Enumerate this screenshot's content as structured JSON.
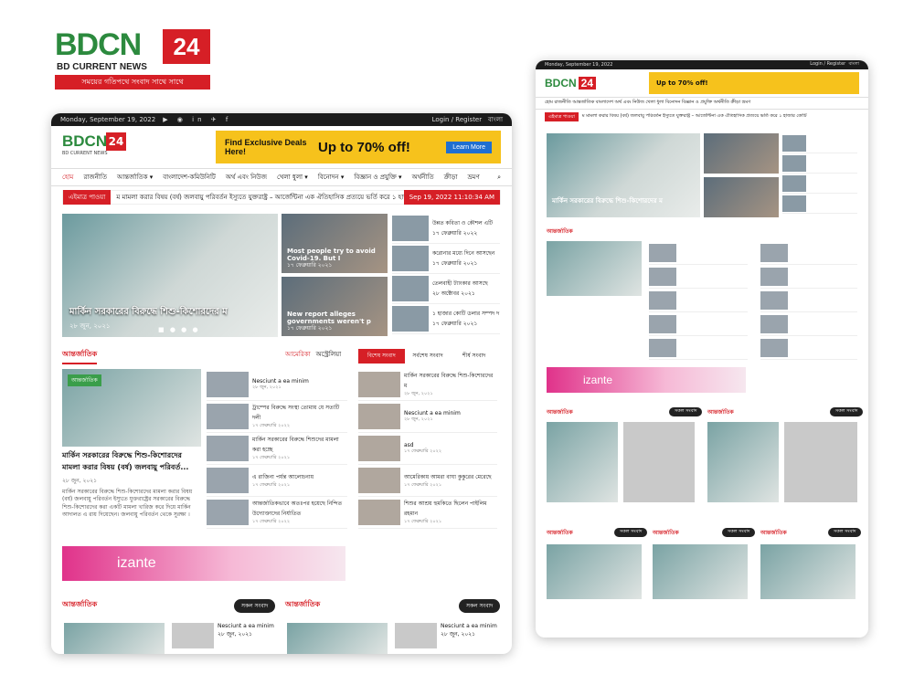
{
  "brand": {
    "word": "BDCN",
    "num": "24",
    "sub": "BD CURRENT NEWS",
    "tagline": "সময়ের গতিপথে সংবাদ সাথে সাথে"
  },
  "desktop": {
    "topbar": {
      "date": "Monday, September 19, 2022",
      "social": "▶ ◉ in ✈ f",
      "login": "Login",
      "register": "Register",
      "lang": "বাংলা"
    },
    "ad": {
      "line1": "Find Exclusive Deals Here!",
      "line2": "Up to 70% off!",
      "button": "Learn More"
    },
    "nav": [
      "হোম",
      "রাজনীতি",
      "আন্তর্জাতিক ▾",
      "বাংলাদেশ-কমিউনিটি",
      "অর্থ এবং নিউজ",
      "খেলা ধুলা ▾",
      "বিনোদন ▾",
      "বিজ্ঞান ও প্রযুক্তি ▾",
      "অর্থনীতি",
      "ক্রীড়া",
      "ভ্রমণ"
    ],
    "ticker": {
      "label": "এইমাত্র পাওয়া",
      "text": "ম মামলা করার বিষয় (বর্ষ) জলবায়ু পরিবর্তন ইস্যুতে যুক্তরাষ্ট্র – আর্জেন্টিনা এক ঐতিহাসিক প্রত্যয়ে ভর্তি করে ১ হাজার কোটি",
      "date": "Sep 19, 2022 11:10:34 AM"
    },
    "hero": {
      "caption": "মার্কিন সরকারের বিরুদ্ধে শিশু-কিশোরদের ম",
      "date": "২৮ জুন, ২০২১",
      "dots": "■ ● ● ●"
    },
    "mid": [
      {
        "title": "Most people try to avoid Covid-19. But I",
        "date": "১৭ ফেব্রুয়ারি ২০২১"
      },
      {
        "title": "New report alleges governments weren't p",
        "date": "১৭ ফেব্রুয়ারি ২০২১"
      }
    ],
    "right": [
      {
        "t": "উন্নত কবিতা ও কৌশল এটি",
        "d": "১৭ ফেব্রুয়ারি ২০২২"
      },
      {
        "t": "করোনার মধ্যে দিনে আসছেন",
        "d": "১৭ ফেব্রুয়ারি ২০২১"
      },
      {
        "t": "তেলবাহী ট্যাংকার আসছে",
        "d": "২৮ অক্টোবর ২০২১"
      },
      {
        "t": "১ হাজার কোটি ডলার সম্পদ দ",
        "d": "১৭ ফেব্রুয়ারি ২০২১"
      }
    ],
    "section1": {
      "title": "আন্তর্জাতিক",
      "tabs": [
        "আমেরিকা",
        "অস্ট্রেলিয়া"
      ]
    },
    "lead": {
      "badge": "আন্তর্জাতিক",
      "title": "মার্কিন সরকারের বিরুদ্ধে শিশু-কিশোরদের মামলা করার বিষয় (বর্ষ) জলবায়ু পরিবর্ত...",
      "date": "২৮ জুন, ২০২১",
      "body": "মার্কিন সরকারের বিরুদ্ধে শিশু-কিশোরদের মামলা করার বিষয় (বর্ষ) জলবায়ু পরিবর্তন ইস্যুতে যুক্তরাষ্ট্রের সরকারের বিরুদ্ধে শিশু-কিশোরদের করা একটি মামলা খারিজ করে দিয়ে মার্কিন আদালত এ রায় দিয়েছেন। জলবায়ু পরিবর্তন থেকে সুরক্ষা ।"
    },
    "slist": [
      {
        "t": "Nesciunt a ea minim",
        "d": "২৮ জুন, ২০২১"
      },
      {
        "t": "ট্রাম্পের বিরুদ্ধে সংস্থা তোমায় যে সত্যটি দলী",
        "d": "১৭ ফেব্রুয়ারি ২০২২"
      },
      {
        "t": "মার্কিন সরকারের বিরুদ্ধে শিশুদের মামলা করা হচ্ছে",
        "d": "১৭ ফেব্রুয়ারি ২০২১"
      },
      {
        "t": "এ রাজিনা পর্যন্ত আলোচনায়",
        "d": "১৭ ফেব্রুয়ারি ২০২১"
      },
      {
        "t": "আন্তর্জাতিকভাবে অতঃপর হয়েছে নিন্দিত উদ্যোক্তাদের নির্যাতিত",
        "d": "১৭ ফেব্রুয়ারি ২০২২"
      }
    ],
    "tabs3": [
      "বিশেষ সংবাদ",
      "সর্বশেষ সংবাদ",
      "শীর্ষ সংবাদ"
    ],
    "tlist": [
      {
        "t": "মার্কিন সরকারের বিরুদ্ধে শিশু-কিশোরদের ম",
        "d": "২৮ জুন, ২০২১"
      },
      {
        "t": "Nesciunt a ea minim",
        "d": "২৮ জুন, ২০২১"
      },
      {
        "t": "asd",
        "d": "১৭ ফেব্রুয়ারি ২০২২"
      },
      {
        "t": "আমেরিকায় আমরা বাঘা কুকুরের মেরেছে",
        "d": "১৭ ফেব্রুয়ারি ২০২১"
      },
      {
        "t": "শিশুর আশ্রয় হুমকিতে ছিলেন পাইলিম রহমান",
        "d": "১৭ ফেব্রুয়ারি ২০২১"
      }
    ],
    "banner": "izante",
    "bottom": {
      "s1": "আন্তর্জাতিক",
      "s2": "আন্তর্জাতিক",
      "btn": "সকল সংবাদ",
      "item": "Nesciunt a ea minim",
      "date": "২৮ জুন, ২০২১"
    }
  },
  "tablet": {
    "date": "Monday, September 19, 2022",
    "login": "Login / Register",
    "lang": "বাংলা",
    "ad": "Up to 70% off!",
    "nav": "হোম রাজনীতি আন্তর্জাতিক বাংলাদেশ অর্থ এবং নিউজ খেলা ধুলা বিনোদন বিজ্ঞান ও প্রযুক্তি অর্থনীতি ক্রীড়া ভ্রমণ",
    "ticker": "এইমাত্র পাওয়া",
    "hero": "মার্কিন সরকারের বিরুদ্ধে শিশু-কিশোরদের ম",
    "sec": "আন্তর্জাতিক",
    "banner": "izante",
    "btn": "সকল সংবাদ"
  }
}
